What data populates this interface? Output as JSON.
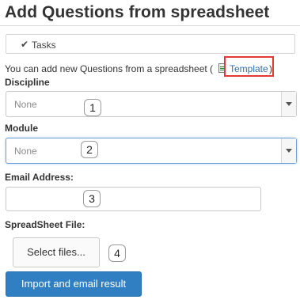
{
  "page": {
    "title": "Add Questions from spreadsheet"
  },
  "tasks": {
    "label": "Tasks",
    "icon": "checkmark-icon"
  },
  "intro": {
    "text_before": "You can add new Questions from a spreadsheet (",
    "link_icon": "spreadsheet-file-icon",
    "link_label": "Template",
    "text_after": ")"
  },
  "form": {
    "discipline": {
      "label": "Discipline",
      "value": "None",
      "callout": "1"
    },
    "module": {
      "label": "Module",
      "value": "None",
      "callout": "2"
    },
    "email": {
      "label": "Email Address:",
      "value": "",
      "callout": "3"
    },
    "spreadsheet": {
      "label": "SpreadSheet File:",
      "button_label": "Select files...",
      "callout": "4"
    },
    "submit_label": "Import and email result"
  },
  "colors": {
    "primary_button": "#2f7fc2",
    "link": "#2a6fb5",
    "highlight_box": "#e53935",
    "focus_border": "#6fa0d6"
  }
}
